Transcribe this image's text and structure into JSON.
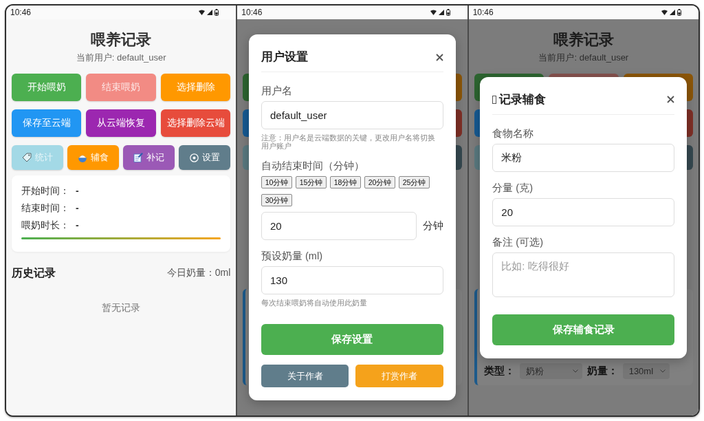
{
  "screens": [
    {
      "kind": "main",
      "status_bar": {
        "time": "10:46"
      },
      "page": {
        "title": "喂养记录",
        "user_label": "当前用户: default_user",
        "action_buttons": [
          {
            "label": "开始喂奶",
            "color": "#4caf50",
            "disabled": false
          },
          {
            "label": "结束喂奶",
            "color": "#f28b84",
            "disabled": true
          },
          {
            "label": "选择删除",
            "color": "#ff9800",
            "disabled": false
          },
          {
            "label": "保存至云端",
            "color": "#2196f3",
            "disabled": false
          },
          {
            "label": "从云端恢复",
            "color": "#9c27b0",
            "disabled": false
          },
          {
            "label": "选择删除云端",
            "color": "#e74c3c",
            "disabled": false
          }
        ],
        "tool_buttons": [
          {
            "kind": "stats",
            "label": "统计",
            "color": "#a3d9e6",
            "disabled": true
          },
          {
            "kind": "food",
            "label": "辅食",
            "color": "#ff9800",
            "disabled": false
          },
          {
            "kind": "supplement",
            "label": "补记",
            "color": "#9b59b6",
            "disabled": false
          },
          {
            "kind": "settings",
            "label": "设置",
            "color": "#607d8b",
            "disabled": false
          }
        ],
        "session": {
          "rows": [
            {
              "label": "开始时间：",
              "value": "-"
            },
            {
              "label": "结束时间：",
              "value": "-"
            },
            {
              "label": "喂奶时长：",
              "value": "-"
            }
          ]
        },
        "history": {
          "title": "历史记录",
          "today_total": "今日奶量：0ml",
          "empty_text": "暂无记录"
        }
      }
    },
    {
      "kind": "dialog",
      "status_bar": {
        "time": "10:46"
      },
      "backdrop": {
        "button_rows": [
          {
            "kind": "large",
            "buttons": [
              {
                "color": "#2d6530"
              },
              {
                "color": "#8c5608"
              }
            ]
          },
          {
            "kind": "large",
            "buttons": [
              {
                "color": "#165a92"
              },
              {
                "color": "#7f2f26"
              }
            ]
          },
          {
            "kind": "small",
            "buttons": [
              {
                "color": "#5a7a80"
              },
              {
                "color": "#354850"
              }
            ]
          }
        ]
      },
      "dialog": {
        "kind": "settings",
        "title": "用户设置",
        "fields": [
          {
            "kind": "text",
            "label": "用户名",
            "value": "default_user",
            "note": "注意：用户名是云端数据的关键，更改用户名将切换用户账户"
          },
          {
            "kind": "presets",
            "label": "自动结束时间（分钟）",
            "options": [
              "10分钟",
              "15分钟",
              "18分钟",
              "20分钟",
              "25分钟",
              "30分钟"
            ],
            "value": "20",
            "unit": "分钟"
          },
          {
            "kind": "text",
            "label": "预设奶量 (ml)",
            "value": "130",
            "note": "每次结束喂奶将自动使用此奶量"
          }
        ],
        "primary_button": "保存设置",
        "secondary_buttons": [
          {
            "label": "关于作者",
            "color": "#607d8b"
          },
          {
            "label": "打赏作者",
            "color": "#f5a21b"
          }
        ]
      }
    },
    {
      "kind": "dialog",
      "status_bar": {
        "time": "10:46"
      },
      "backdrop": {
        "title": "喂养记录",
        "user_label": "当前用户: default_user",
        "button_rows": [
          {
            "kind": "large",
            "buttons": [
              {
                "color": "#2d6530"
              },
              {
                "color": "#86524e"
              },
              {
                "color": "#8c5608"
              }
            ]
          },
          {
            "kind": "large",
            "buttons": [
              {
                "color": "#165a92"
              },
              {
                "color": "#7f2f26"
              }
            ]
          },
          {
            "kind": "small",
            "buttons": [
              {
                "color": "#5a7a80"
              },
              {
                "color": "#354850"
              }
            ]
          }
        ],
        "record": {
          "type_label": "类型：",
          "type_value": "奶粉",
          "amount_label": "奶量：",
          "amount_value": "130ml"
        }
      },
      "dialog": {
        "kind": "food",
        "title": "记录辅食",
        "fields": [
          {
            "kind": "text",
            "label": "食物名称",
            "value": "米粉"
          },
          {
            "kind": "text",
            "label": "分量 (克)",
            "value": "20"
          },
          {
            "kind": "textarea",
            "label": "备注 (可选)",
            "placeholder": "比如: 吃得很好"
          }
        ],
        "primary_button": "保存辅食记录"
      }
    }
  ]
}
